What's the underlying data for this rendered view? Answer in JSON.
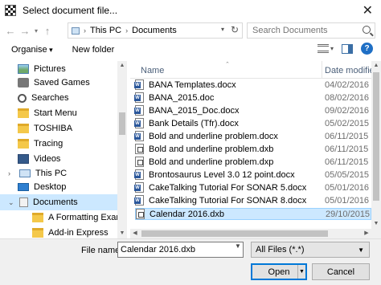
{
  "window": {
    "title": "Select document file..."
  },
  "address_bar": {
    "segments": [
      "This PC",
      "Documents"
    ]
  },
  "search": {
    "placeholder": "Search Documents"
  },
  "toolbar": {
    "organise_label": "Organise",
    "new_folder_label": "New folder"
  },
  "nav_pane": {
    "items": [
      {
        "label": "Pictures",
        "icon": "pictures-icon"
      },
      {
        "label": "Saved Games",
        "icon": "saved-games-icon"
      },
      {
        "label": "Searches",
        "icon": "search-folder-icon"
      },
      {
        "label": "Start Menu",
        "icon": "folder-icon"
      },
      {
        "label": "TOSHIBA",
        "icon": "folder-icon"
      },
      {
        "label": "Tracing",
        "icon": "folder-icon"
      },
      {
        "label": "Videos",
        "icon": "videos-icon"
      },
      {
        "label": "This PC",
        "icon": "this-pc-icon"
      },
      {
        "label": "Desktop",
        "icon": "desktop-icon"
      },
      {
        "label": "Documents",
        "icon": "documents-icon",
        "selected": true
      },
      {
        "label": "A Formatting Example",
        "icon": "folder-icon"
      },
      {
        "label": "Add-in Express",
        "icon": "folder-icon"
      }
    ]
  },
  "file_list": {
    "columns": {
      "name": "Name",
      "date": "Date modified"
    },
    "rows": [
      {
        "name": "BANA Templates.docx",
        "date": "04/02/2016 ",
        "icon": "word-doc-icon"
      },
      {
        "name": "BANA_2015.doc",
        "date": "08/02/2016 ",
        "icon": "word-doc-icon"
      },
      {
        "name": "BANA_2015_Doc.docx",
        "date": "09/02/2016 ",
        "icon": "word-doc-icon"
      },
      {
        "name": "Bank Details (Tfr).docx",
        "date": "05/02/2015 ",
        "icon": "word-doc-icon"
      },
      {
        "name": "Bold and underline problem.docx",
        "date": "06/11/2015 ",
        "icon": "word-doc-icon"
      },
      {
        "name": "Bold and underline problem.dxb",
        "date": "06/11/2015 ",
        "icon": "dxb-file-icon"
      },
      {
        "name": "Bold and underline problem.dxp",
        "date": "06/11/2015 ",
        "icon": "dxb-file-icon"
      },
      {
        "name": "Brontosaurus Level 3.0 12 point.docx",
        "date": "05/05/2015 ",
        "icon": "word-doc-icon"
      },
      {
        "name": "CakeTalking Tutorial For SONAR 5.docx",
        "date": "05/01/2016 ",
        "icon": "word-doc-icon"
      },
      {
        "name": "CakeTalking Tutorial For SONAR 8.docx",
        "date": "05/01/2016 ",
        "icon": "word-doc-icon"
      },
      {
        "name": "Calendar 2016.dxb",
        "date": "29/10/2015 ",
        "icon": "dxb-file-icon",
        "selected": true
      }
    ]
  },
  "footer": {
    "file_name_label": "File name:",
    "file_name_value": "Calendar 2016.dxb",
    "file_type_value": "All Files (*.*)",
    "open_label": "Open",
    "cancel_label": "Cancel"
  }
}
